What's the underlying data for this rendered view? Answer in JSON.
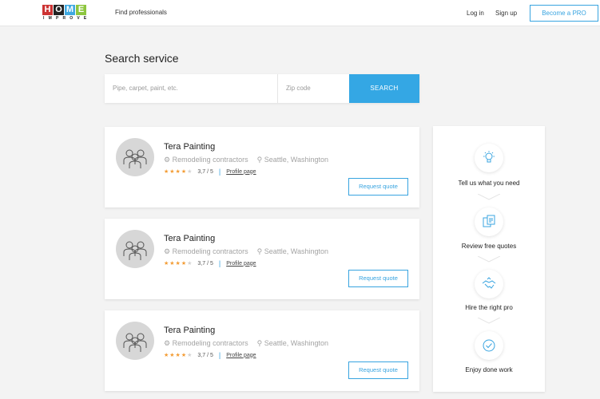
{
  "header": {
    "logo_top": [
      "H",
      "O",
      "M",
      "E"
    ],
    "logo_colors": [
      "#cc3333",
      "#222222",
      "#3fa9e0",
      "#8dc63f"
    ],
    "logo_bottom": "IMPROVE",
    "nav_find": "Find professionals",
    "login": "Log in",
    "signup": "Sign up",
    "pro_button": "Become a PRO"
  },
  "search": {
    "title": "Search service",
    "service_placeholder": "Pipe, carpet, paint, etc.",
    "zip_placeholder": "Zip code",
    "button": "SEARCH"
  },
  "cards": [
    {
      "name": "Tera Painting",
      "category": "Remodeling contractors",
      "location": "Seattle, Washington",
      "rating": "3,7 / 5",
      "profile_link": "Profile page",
      "quote_button": "Request quote"
    },
    {
      "name": "Tera Painting",
      "category": "Remodeling contractors",
      "location": "Seattle, Washington",
      "rating": "3,7 / 5",
      "profile_link": "Profile page",
      "quote_button": "Request quote"
    },
    {
      "name": "Tera Painting",
      "category": "Remodeling contractors",
      "location": "Seattle, Washington",
      "rating": "3,7 / 5",
      "profile_link": "Profile page",
      "quote_button": "Request quote"
    }
  ],
  "steps": [
    {
      "label": "Tell us what you need",
      "icon": "lightbulb-icon"
    },
    {
      "label": "Review free quotes",
      "icon": "documents-icon"
    },
    {
      "label": "Hire the right pro",
      "icon": "handshake-icon"
    },
    {
      "label": "Enjoy done work",
      "icon": "checkmark-icon"
    }
  ],
  "colors": {
    "accent": "#38a4e0",
    "star": "#f39c34"
  }
}
